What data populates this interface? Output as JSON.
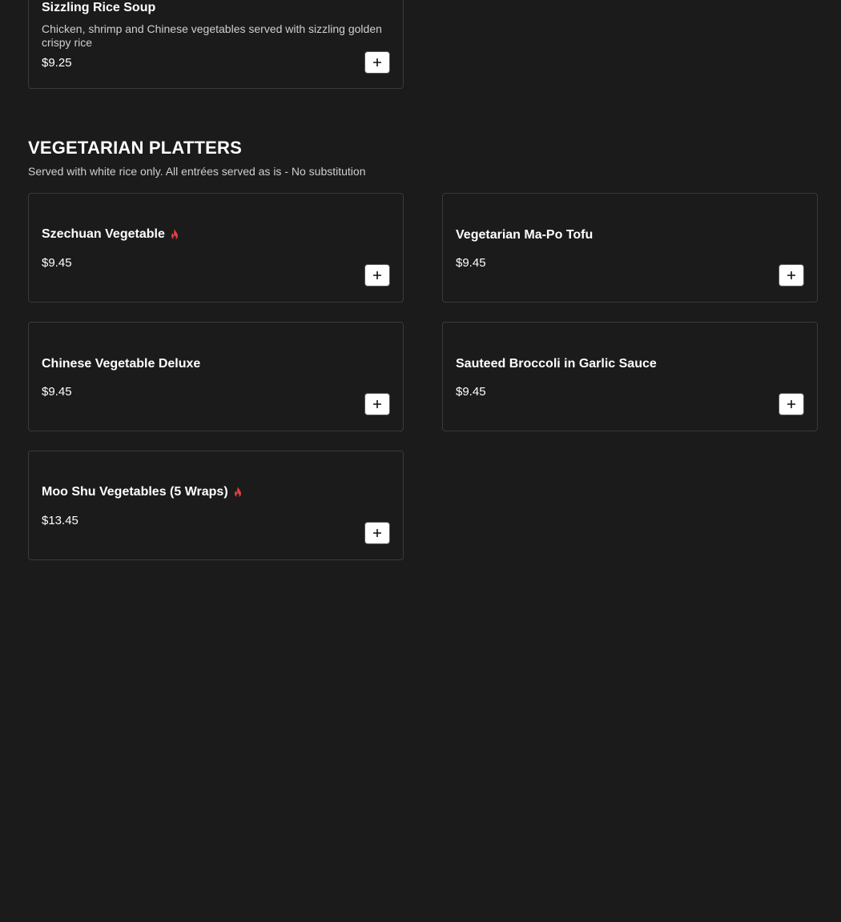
{
  "top_item": {
    "name": "Sizzling Rice Soup",
    "description": "Chicken, shrimp and Chinese vegetables served with sizzling golden crispy rice",
    "price": "$9.25"
  },
  "section": {
    "title": "VEGETARIAN PLATTERS",
    "subtitle": "Served with white rice only. All entrées served as is - No substitution"
  },
  "items": [
    {
      "name": "Szechuan Vegetable",
      "price": "$9.45",
      "spicy": true
    },
    {
      "name": "Vegetarian Ma-Po Tofu",
      "price": "$9.45",
      "spicy": false
    },
    {
      "name": "Chinese Vegetable Deluxe",
      "price": "$9.45",
      "spicy": false
    },
    {
      "name": "Sauteed Broccoli in Garlic Sauce",
      "price": "$9.45",
      "spicy": false
    },
    {
      "name": "Moo Shu Vegetables (5 Wraps)",
      "price": "$13.45",
      "spicy": true
    }
  ],
  "colors": {
    "background": "#1b1b1b",
    "card_border": "#3a3a3a",
    "spicy_icon": "#e04040",
    "button_bg": "#ffffff"
  },
  "icons": {
    "add": "plus-icon",
    "spicy": "flame-icon"
  }
}
